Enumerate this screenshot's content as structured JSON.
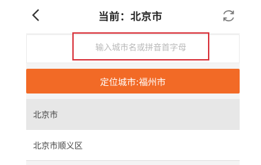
{
  "header": {
    "title": "当前：北京市",
    "back_icon": "chevron-left-icon",
    "refresh_icon": "refresh-icon"
  },
  "search": {
    "placeholder": "输入城市名或拼音首字母",
    "value": ""
  },
  "locate": {
    "label": "定位城市:福州市"
  },
  "cities": [
    {
      "name": "北京市",
      "selected": true
    },
    {
      "name": "北京市顺义区",
      "selected": false
    }
  ],
  "colors": {
    "accent": "#f26a26",
    "highlight_border": "#d9363e",
    "selected_bg": "#e7e7e7"
  }
}
